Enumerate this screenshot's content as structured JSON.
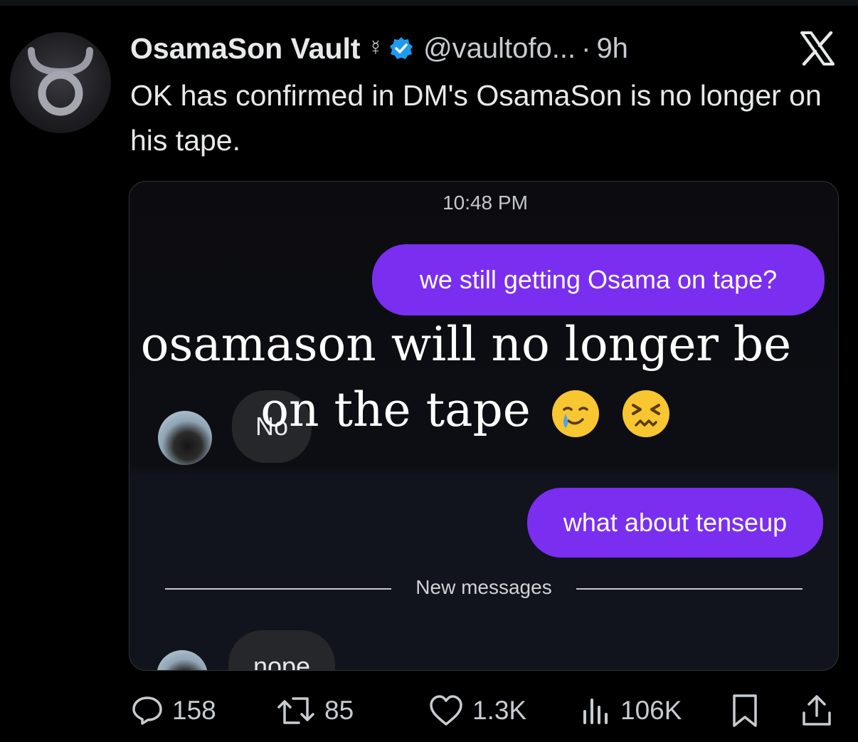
{
  "tweet": {
    "author_name": "OsamaSon Vault",
    "author_symbol": "☿",
    "handle": "@vaultofo...",
    "separator": "·",
    "time_ago": "9h",
    "text": "OK has confirmed in DM's OsamaSon is no longer on his tape."
  },
  "dm": {
    "timestamp": "10:48 PM",
    "messages": [
      {
        "text": "we still getting Osama on tape?"
      },
      {
        "text": "No"
      },
      {
        "text": "what about tenseup"
      },
      {
        "text": "nope"
      }
    ],
    "new_messages_label": "New messages"
  },
  "overlay": {
    "text": "osamason will no longer be on the tape"
  },
  "actions": {
    "replies": "158",
    "reposts": "85",
    "likes": "1.3K",
    "views": "106K"
  },
  "colors": {
    "background": "#000000",
    "outgoing_bubble": "#7a2ef0",
    "incoming_bubble": "#26272b",
    "verified_badge": "#1d9bf0"
  },
  "icons": [
    "app-avatar-taurus-icon",
    "verified-badge-icon",
    "x-logo-icon",
    "reply-icon",
    "repost-icon",
    "like-icon",
    "views-icon",
    "bookmark-icon",
    "share-icon",
    "crying-smile-emoji",
    "confounded-face-emoji"
  ]
}
